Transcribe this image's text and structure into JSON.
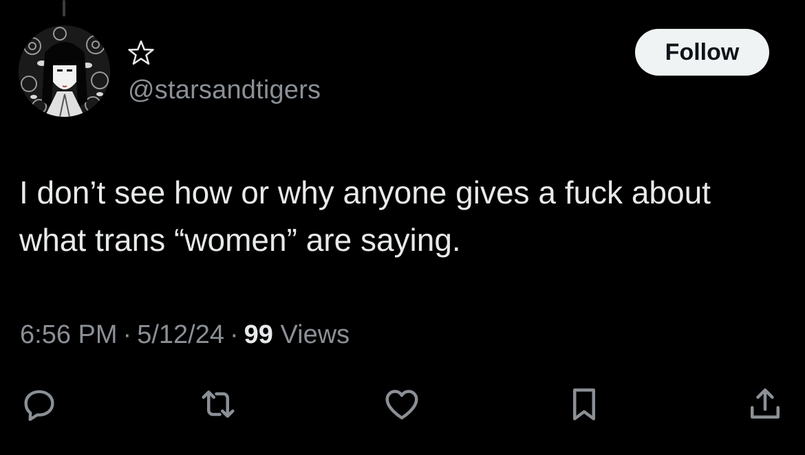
{
  "theme": {
    "background": "#000000",
    "text_primary": "#e7e9ea",
    "text_secondary": "#8b9096",
    "button_bg": "#eff3f4",
    "button_text": "#0f1419"
  },
  "author": {
    "display_name_icon": "star-outline-icon",
    "handle": "@starsandtigers"
  },
  "follow_button": {
    "label": "Follow"
  },
  "tweet": {
    "text_lines": [
      "I don’t see how or why anyone gives a fuck about",
      "what trans “women” are saying."
    ],
    "time": "6:56 PM",
    "separator": "·",
    "date": "5/12/24",
    "views_count": "99",
    "views_label": "Views"
  },
  "actions": [
    {
      "icon": "reply-icon"
    },
    {
      "icon": "retweet-icon"
    },
    {
      "icon": "like-icon"
    },
    {
      "icon": "bookmark-icon"
    },
    {
      "icon": "share-icon"
    }
  ]
}
